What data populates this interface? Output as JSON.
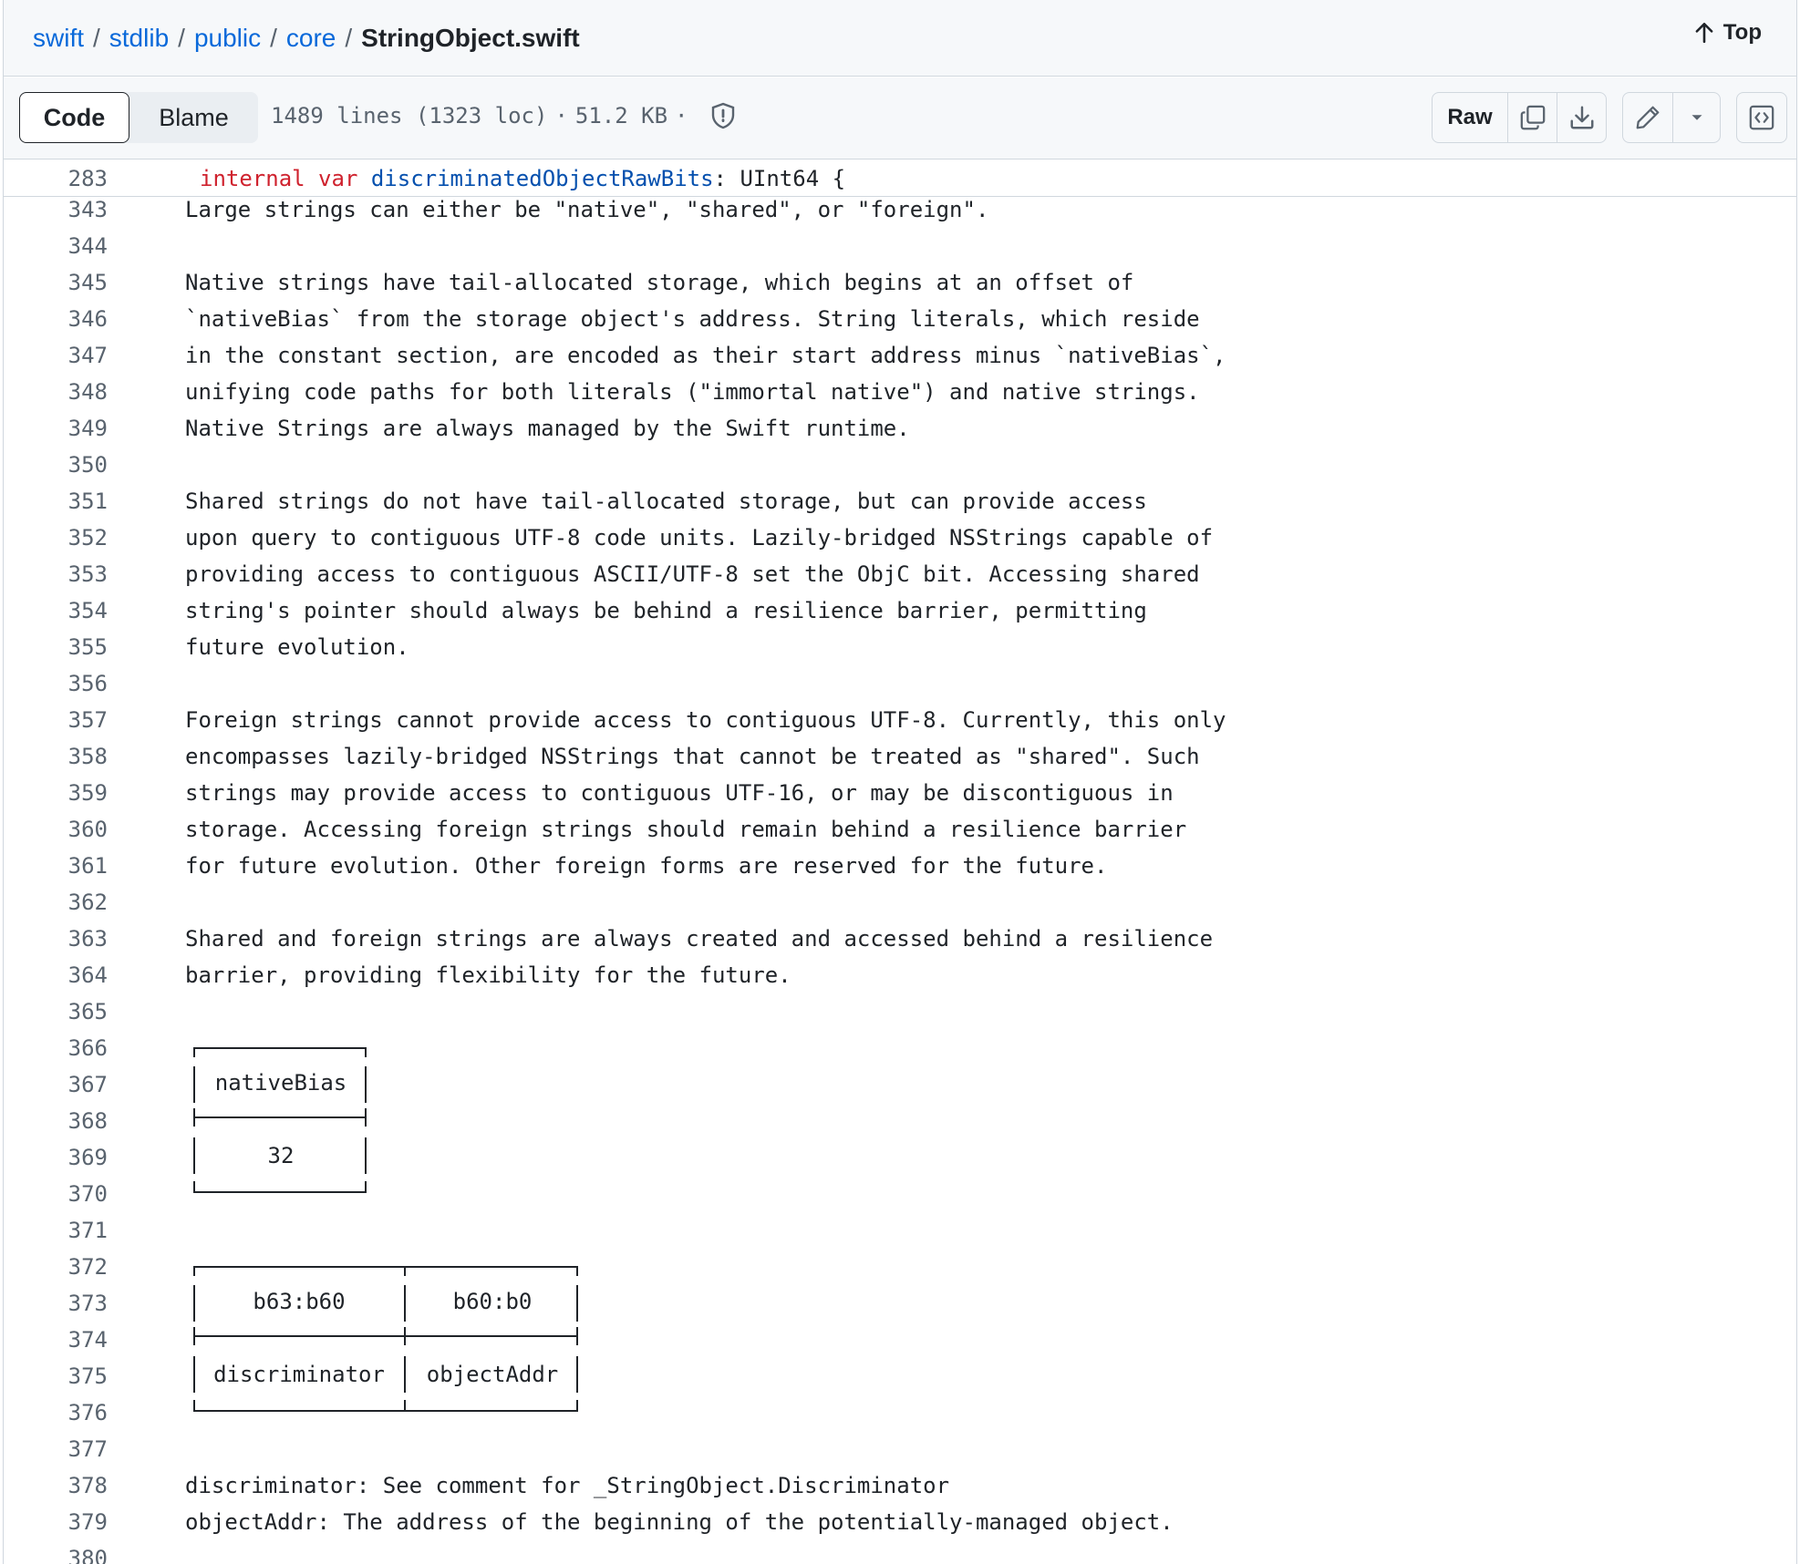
{
  "breadcrumb": {
    "parts": [
      "swift",
      "stdlib",
      "public",
      "core"
    ],
    "file": "StringObject.swift",
    "separator": "/"
  },
  "top_button": {
    "label": "Top",
    "icon": "arrow-up-icon"
  },
  "toolbar": {
    "code_tab": "Code",
    "blame_tab": "Blame",
    "lines": "1489 lines (1323 loc)",
    "size": "51.2 KB",
    "dot": "·",
    "raw_label": "Raw",
    "icons": [
      "shield-icon",
      "copy-icon",
      "download-icon",
      "pencil-icon",
      "chevron-down-icon",
      "code-square-icon"
    ]
  },
  "sticky_line": {
    "number": "283",
    "keyword1": "internal",
    "keyword2": "var",
    "ident": "discriminatedObjectRawBits",
    "rest": ": UInt64 {"
  },
  "code_lines": [
    {
      "n": "343",
      "t": "Large strings can either be \"native\", \"shared\", or \"foreign\"."
    },
    {
      "n": "344",
      "t": ""
    },
    {
      "n": "345",
      "t": "Native strings have tail-allocated storage, which begins at an offset of"
    },
    {
      "n": "346",
      "t": "`nativeBias` from the storage object's address. String literals, which reside"
    },
    {
      "n": "347",
      "t": "in the constant section, are encoded as their start address minus `nativeBias`,"
    },
    {
      "n": "348",
      "t": "unifying code paths for both literals (\"immortal native\") and native strings."
    },
    {
      "n": "349",
      "t": "Native Strings are always managed by the Swift runtime."
    },
    {
      "n": "350",
      "t": ""
    },
    {
      "n": "351",
      "t": "Shared strings do not have tail-allocated storage, but can provide access"
    },
    {
      "n": "352",
      "t": "upon query to contiguous UTF-8 code units. Lazily-bridged NSStrings capable of"
    },
    {
      "n": "353",
      "t": "providing access to contiguous ASCII/UTF-8 set the ObjC bit. Accessing shared"
    },
    {
      "n": "354",
      "t": "string's pointer should always be behind a resilience barrier, permitting"
    },
    {
      "n": "355",
      "t": "future evolution."
    },
    {
      "n": "356",
      "t": ""
    },
    {
      "n": "357",
      "t": "Foreign strings cannot provide access to contiguous UTF-8. Currently, this only"
    },
    {
      "n": "358",
      "t": "encompasses lazily-bridged NSStrings that cannot be treated as \"shared\". Such"
    },
    {
      "n": "359",
      "t": "strings may provide access to contiguous UTF-16, or may be discontiguous in"
    },
    {
      "n": "360",
      "t": "storage. Accessing foreign strings should remain behind a resilience barrier"
    },
    {
      "n": "361",
      "t": "for future evolution. Other foreign forms are reserved for the future."
    },
    {
      "n": "362",
      "t": ""
    },
    {
      "n": "363",
      "t": "Shared and foreign strings are always created and accessed behind a resilience"
    },
    {
      "n": "364",
      "t": "barrier, providing flexibility for the future."
    },
    {
      "n": "365",
      "t": ""
    },
    {
      "n": "366",
      "t": ""
    },
    {
      "n": "367",
      "t": ""
    },
    {
      "n": "368",
      "t": ""
    },
    {
      "n": "369",
      "t": ""
    },
    {
      "n": "370",
      "t": ""
    },
    {
      "n": "371",
      "t": ""
    },
    {
      "n": "372",
      "t": ""
    },
    {
      "n": "373",
      "t": ""
    },
    {
      "n": "374",
      "t": ""
    },
    {
      "n": "375",
      "t": ""
    },
    {
      "n": "376",
      "t": ""
    },
    {
      "n": "377",
      "t": ""
    },
    {
      "n": "378",
      "t": "discriminator: See comment for _StringObject.Discriminator"
    },
    {
      "n": "379",
      "t": "objectAddr: The address of the beginning of the potentially-managed object."
    },
    {
      "n": "380",
      "t": ""
    }
  ],
  "diagram1": {
    "header": "nativeBias",
    "value": "32"
  },
  "diagram2": {
    "headers": [
      "b63:b60",
      "b60:b0"
    ],
    "values": [
      "discriminator",
      "objectAddr"
    ]
  }
}
